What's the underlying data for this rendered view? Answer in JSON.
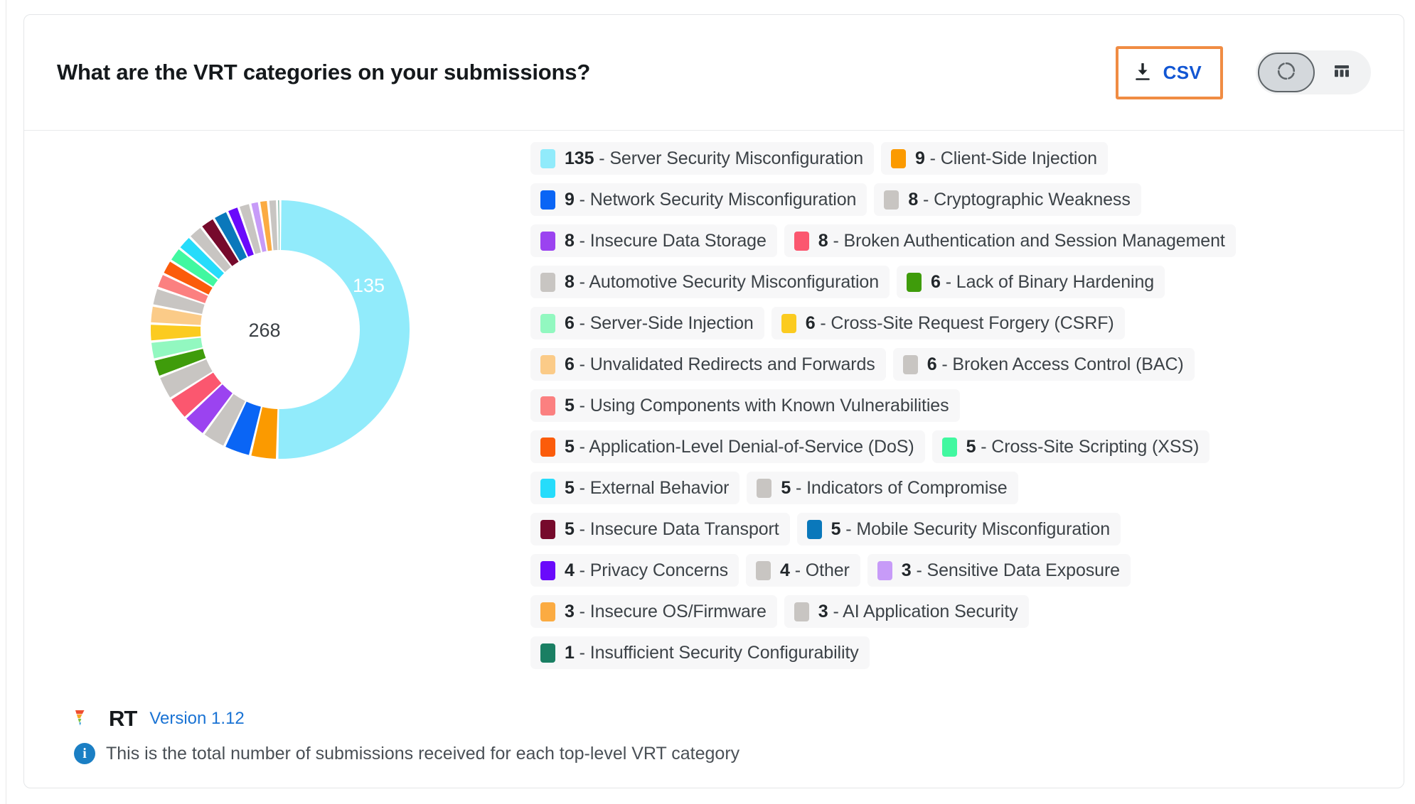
{
  "header": {
    "title": "What are the VRT categories on your submissions?",
    "csv_label": "CSV",
    "csv_icon": "download-icon",
    "highlight_color": "#f08c43",
    "toggle": {
      "chart_icon": "donut-chart-icon",
      "table_icon": "table-icon",
      "selected": "chart"
    }
  },
  "chart_data": {
    "type": "pie",
    "variant": "donut",
    "title": "What are the VRT categories on your submissions?",
    "center_label": "268",
    "total": 268,
    "labeled_slices": [
      {
        "label": "135",
        "value": 135
      }
    ],
    "legend_position": "right",
    "categories": [
      "Server Security Misconfiguration",
      "Client-Side Injection",
      "Network Security Misconfiguration",
      "Cryptographic Weakness",
      "Insecure Data Storage",
      "Broken Authentication and Session Management",
      "Automotive Security Misconfiguration",
      "Lack of Binary Hardening",
      "Server-Side Injection",
      "Cross-Site Request Forgery (CSRF)",
      "Unvalidated Redirects and Forwards",
      "Broken Access Control (BAC)",
      "Using Components with Known Vulnerabilities",
      "Application-Level Denial-of-Service (DoS)",
      "Cross-Site Scripting (XSS)",
      "External Behavior",
      "Indicators of Compromise",
      "Insecure Data Transport",
      "Mobile Security Misconfiguration",
      "Privacy Concerns",
      "Other",
      "Sensitive Data Exposure",
      "Insecure OS/Firmware",
      "AI Application Security",
      "Insufficient Security Configurability"
    ],
    "values": [
      135,
      9,
      9,
      8,
      8,
      8,
      8,
      6,
      6,
      6,
      6,
      6,
      5,
      5,
      5,
      5,
      5,
      5,
      5,
      4,
      4,
      3,
      3,
      3,
      1
    ],
    "colors": [
      "#91ebfb",
      "#fb9a00",
      "#0a65f5",
      "#c8c5c2",
      "#9b43f0",
      "#fb576f",
      "#c8c5c2",
      "#3f9c0b",
      "#92f8c0",
      "#fbcb20",
      "#fbcb88",
      "#c8c5c2",
      "#fb8080",
      "#fb5c0b",
      "#41f8a0",
      "#26dcfb",
      "#c8c5c2",
      "#760a2c",
      "#0a78bb",
      "#6a0afb",
      "#c8c5c2",
      "#c79bf8",
      "#fbab42",
      "#c8c5c2",
      "#1a7f63"
    ]
  },
  "legend_rows": [
    [
      {
        "value": "135",
        "name": "Server Security Misconfiguration",
        "color": "#91ebfb"
      },
      {
        "value": "9",
        "name": "Client-Side Injection",
        "color": "#fb9a00"
      }
    ],
    [
      {
        "value": "9",
        "name": "Network Security Misconfiguration",
        "color": "#0a65f5"
      },
      {
        "value": "8",
        "name": "Cryptographic Weakness",
        "color": "#c8c5c2"
      }
    ],
    [
      {
        "value": "8",
        "name": "Insecure Data Storage",
        "color": "#9b43f0"
      },
      {
        "value": "8",
        "name": "Broken Authentication and Session Management",
        "color": "#fb576f"
      }
    ],
    [
      {
        "value": "8",
        "name": "Automotive Security Misconfiguration",
        "color": "#c8c5c2"
      },
      {
        "value": "6",
        "name": "Lack of Binary Hardening",
        "color": "#3f9c0b"
      }
    ],
    [
      {
        "value": "6",
        "name": "Server-Side Injection",
        "color": "#92f8c0"
      },
      {
        "value": "6",
        "name": "Cross-Site Request Forgery (CSRF)",
        "color": "#fbcb20"
      }
    ],
    [
      {
        "value": "6",
        "name": "Unvalidated Redirects and Forwards",
        "color": "#fbcb88"
      },
      {
        "value": "6",
        "name": "Broken Access Control (BAC)",
        "color": "#c8c5c2"
      }
    ],
    [
      {
        "value": "5",
        "name": "Using Components with Known Vulnerabilities",
        "color": "#fb8080"
      }
    ],
    [
      {
        "value": "5",
        "name": "Application-Level Denial-of-Service (DoS)",
        "color": "#fb5c0b"
      },
      {
        "value": "5",
        "name": "Cross-Site Scripting (XSS)",
        "color": "#41f8a0"
      }
    ],
    [
      {
        "value": "5",
        "name": "External Behavior",
        "color": "#26dcfb"
      },
      {
        "value": "5",
        "name": "Indicators of Compromise",
        "color": "#c8c5c2"
      }
    ],
    [
      {
        "value": "5",
        "name": "Insecure Data Transport",
        "color": "#760a2c"
      },
      {
        "value": "5",
        "name": "Mobile Security Misconfiguration",
        "color": "#0a78bb"
      }
    ],
    [
      {
        "value": "4",
        "name": "Privacy Concerns",
        "color": "#6a0afb"
      },
      {
        "value": "4",
        "name": "Other",
        "color": "#c8c5c2"
      },
      {
        "value": "3",
        "name": "Sensitive Data Exposure",
        "color": "#c79bf8"
      }
    ],
    [
      {
        "value": "3",
        "name": "Insecure OS/Firmware",
        "color": "#fbab42"
      },
      {
        "value": "3",
        "name": "AI Application Security",
        "color": "#c8c5c2"
      }
    ],
    [
      {
        "value": "1",
        "name": "Insufficient Security Configurability",
        "color": "#1a7f63"
      }
    ]
  ],
  "footer": {
    "logo_text": "RT",
    "version": "Version 1.12",
    "note": "This is the total number of submissions received for each top-level VRT category",
    "info_icon": "info-icon"
  }
}
